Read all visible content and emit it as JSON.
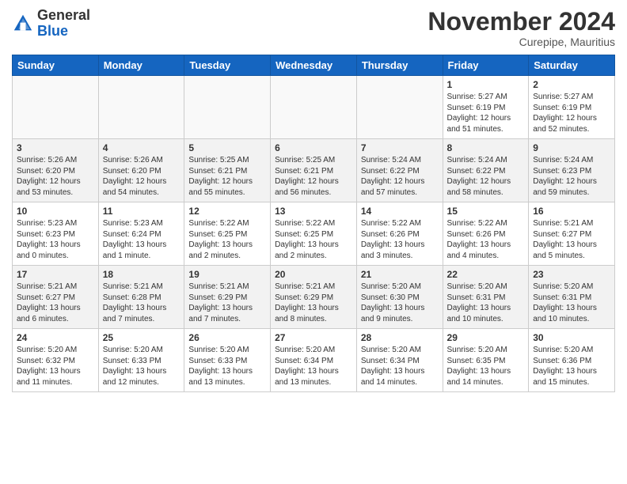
{
  "header": {
    "logo_general": "General",
    "logo_blue": "Blue",
    "month_title": "November 2024",
    "location": "Curepipe, Mauritius"
  },
  "days_of_week": [
    "Sunday",
    "Monday",
    "Tuesday",
    "Wednesday",
    "Thursday",
    "Friday",
    "Saturday"
  ],
  "weeks": [
    [
      {
        "day": "",
        "info": ""
      },
      {
        "day": "",
        "info": ""
      },
      {
        "day": "",
        "info": ""
      },
      {
        "day": "",
        "info": ""
      },
      {
        "day": "",
        "info": ""
      },
      {
        "day": "1",
        "info": "Sunrise: 5:27 AM\nSunset: 6:19 PM\nDaylight: 12 hours\nand 51 minutes."
      },
      {
        "day": "2",
        "info": "Sunrise: 5:27 AM\nSunset: 6:19 PM\nDaylight: 12 hours\nand 52 minutes."
      }
    ],
    [
      {
        "day": "3",
        "info": "Sunrise: 5:26 AM\nSunset: 6:20 PM\nDaylight: 12 hours\nand 53 minutes."
      },
      {
        "day": "4",
        "info": "Sunrise: 5:26 AM\nSunset: 6:20 PM\nDaylight: 12 hours\nand 54 minutes."
      },
      {
        "day": "5",
        "info": "Sunrise: 5:25 AM\nSunset: 6:21 PM\nDaylight: 12 hours\nand 55 minutes."
      },
      {
        "day": "6",
        "info": "Sunrise: 5:25 AM\nSunset: 6:21 PM\nDaylight: 12 hours\nand 56 minutes."
      },
      {
        "day": "7",
        "info": "Sunrise: 5:24 AM\nSunset: 6:22 PM\nDaylight: 12 hours\nand 57 minutes."
      },
      {
        "day": "8",
        "info": "Sunrise: 5:24 AM\nSunset: 6:22 PM\nDaylight: 12 hours\nand 58 minutes."
      },
      {
        "day": "9",
        "info": "Sunrise: 5:24 AM\nSunset: 6:23 PM\nDaylight: 12 hours\nand 59 minutes."
      }
    ],
    [
      {
        "day": "10",
        "info": "Sunrise: 5:23 AM\nSunset: 6:23 PM\nDaylight: 13 hours\nand 0 minutes."
      },
      {
        "day": "11",
        "info": "Sunrise: 5:23 AM\nSunset: 6:24 PM\nDaylight: 13 hours\nand 1 minute."
      },
      {
        "day": "12",
        "info": "Sunrise: 5:22 AM\nSunset: 6:25 PM\nDaylight: 13 hours\nand 2 minutes."
      },
      {
        "day": "13",
        "info": "Sunrise: 5:22 AM\nSunset: 6:25 PM\nDaylight: 13 hours\nand 2 minutes."
      },
      {
        "day": "14",
        "info": "Sunrise: 5:22 AM\nSunset: 6:26 PM\nDaylight: 13 hours\nand 3 minutes."
      },
      {
        "day": "15",
        "info": "Sunrise: 5:22 AM\nSunset: 6:26 PM\nDaylight: 13 hours\nand 4 minutes."
      },
      {
        "day": "16",
        "info": "Sunrise: 5:21 AM\nSunset: 6:27 PM\nDaylight: 13 hours\nand 5 minutes."
      }
    ],
    [
      {
        "day": "17",
        "info": "Sunrise: 5:21 AM\nSunset: 6:27 PM\nDaylight: 13 hours\nand 6 minutes."
      },
      {
        "day": "18",
        "info": "Sunrise: 5:21 AM\nSunset: 6:28 PM\nDaylight: 13 hours\nand 7 minutes."
      },
      {
        "day": "19",
        "info": "Sunrise: 5:21 AM\nSunset: 6:29 PM\nDaylight: 13 hours\nand 7 minutes."
      },
      {
        "day": "20",
        "info": "Sunrise: 5:21 AM\nSunset: 6:29 PM\nDaylight: 13 hours\nand 8 minutes."
      },
      {
        "day": "21",
        "info": "Sunrise: 5:20 AM\nSunset: 6:30 PM\nDaylight: 13 hours\nand 9 minutes."
      },
      {
        "day": "22",
        "info": "Sunrise: 5:20 AM\nSunset: 6:31 PM\nDaylight: 13 hours\nand 10 minutes."
      },
      {
        "day": "23",
        "info": "Sunrise: 5:20 AM\nSunset: 6:31 PM\nDaylight: 13 hours\nand 10 minutes."
      }
    ],
    [
      {
        "day": "24",
        "info": "Sunrise: 5:20 AM\nSunset: 6:32 PM\nDaylight: 13 hours\nand 11 minutes."
      },
      {
        "day": "25",
        "info": "Sunrise: 5:20 AM\nSunset: 6:33 PM\nDaylight: 13 hours\nand 12 minutes."
      },
      {
        "day": "26",
        "info": "Sunrise: 5:20 AM\nSunset: 6:33 PM\nDaylight: 13 hours\nand 13 minutes."
      },
      {
        "day": "27",
        "info": "Sunrise: 5:20 AM\nSunset: 6:34 PM\nDaylight: 13 hours\nand 13 minutes."
      },
      {
        "day": "28",
        "info": "Sunrise: 5:20 AM\nSunset: 6:34 PM\nDaylight: 13 hours\nand 14 minutes."
      },
      {
        "day": "29",
        "info": "Sunrise: 5:20 AM\nSunset: 6:35 PM\nDaylight: 13 hours\nand 14 minutes."
      },
      {
        "day": "30",
        "info": "Sunrise: 5:20 AM\nSunset: 6:36 PM\nDaylight: 13 hours\nand 15 minutes."
      }
    ]
  ]
}
